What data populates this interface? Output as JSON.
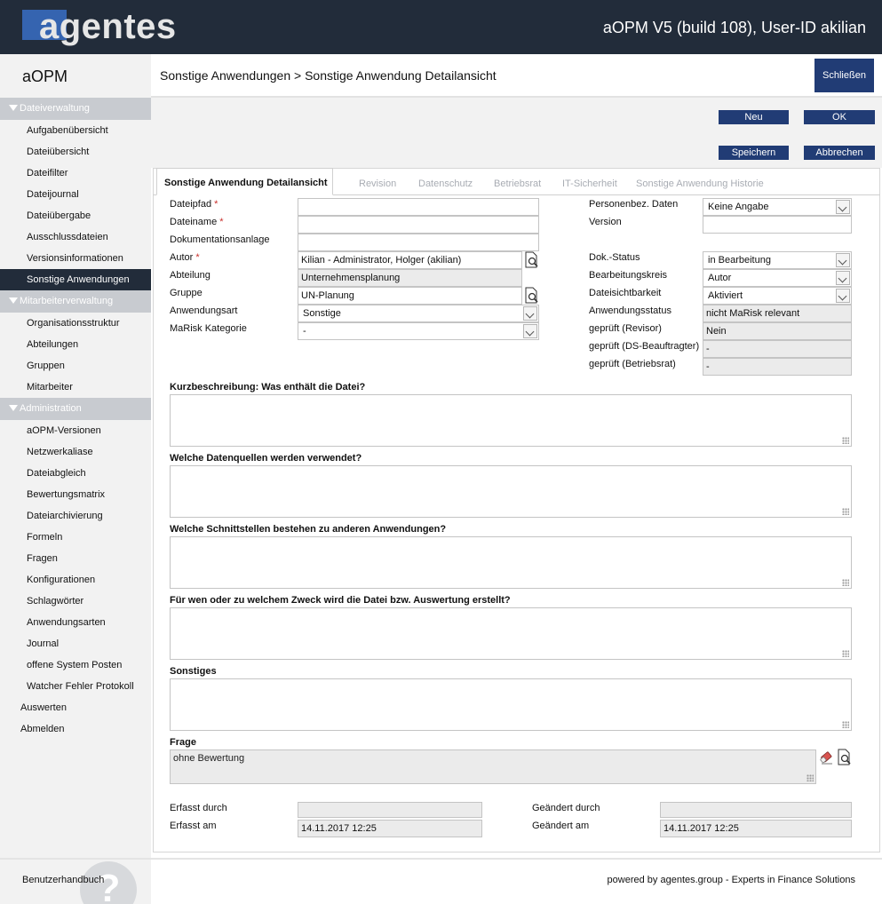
{
  "header": {
    "logo": "agentes",
    "app_info": "aOPM V5 (build 108), User-ID akilian"
  },
  "sidebar": {
    "title": "aOPM",
    "sections": [
      {
        "label": "Dateiverwaltung",
        "items": [
          "Aufgabenübersicht",
          "Dateiübersicht",
          "Dateifilter",
          "Dateijournal",
          "Dateiübergabe",
          "Ausschlussdateien",
          "Versionsinformationen",
          "Sonstige Anwendungen"
        ]
      },
      {
        "label": "Mitarbeiterverwaltung",
        "items": [
          "Organisationsstruktur",
          "Abteilungen",
          "Gruppen",
          "Mitarbeiter"
        ]
      },
      {
        "label": "Administration",
        "items": [
          "aOPM-Versionen",
          "Netzwerkaliase",
          "Dateiabgleich",
          "Bewertungsmatrix",
          "Dateiarchivierung",
          "Formeln",
          "Fragen",
          "Konfigurationen",
          "Schlagwörter",
          "Anwendungsarten",
          "Journal",
          "offene System Posten",
          "Watcher Fehler Protokoll"
        ]
      }
    ],
    "active_item": "Sonstige Anwendungen",
    "bottom_items": [
      "Auswerten",
      "Abmelden"
    ]
  },
  "page": {
    "breadcrumb": "Sonstige Anwendungen > Sonstige Anwendung Detailansicht",
    "close_label": "Schließen"
  },
  "toolbar": {
    "new_label": "Neu",
    "ok_label": "OK",
    "save_label": "Speichern",
    "cancel_label": "Abbrechen"
  },
  "tabs": [
    "Sonstige Anwendung Detailansicht",
    "Revision",
    "Datenschutz",
    "Betriebsrat",
    "IT-Sicherheit",
    "Sonstige Anwendung Historie"
  ],
  "form": {
    "required_mark": "*",
    "left": {
      "dateipfad": {
        "label": "Dateipfad",
        "value": ""
      },
      "dateiname": {
        "label": "Dateiname",
        "value": ""
      },
      "dokumentationsanlage": {
        "label": "Dokumentationsanlage",
        "value": ""
      },
      "autor": {
        "label": "Autor",
        "value": "Kilian - Administrator, Holger (akilian)"
      },
      "abteilung": {
        "label": "Abteilung",
        "value": "Unternehmensplanung"
      },
      "gruppe": {
        "label": "Gruppe",
        "value": "UN-Planung"
      },
      "anwendungsart": {
        "label": "Anwendungsart",
        "value": "Sonstige"
      },
      "marisk": {
        "label": "MaRisk Kategorie",
        "value": "-"
      }
    },
    "right": {
      "personenbez": {
        "label": "Personenbez. Daten",
        "value": "Keine Angabe"
      },
      "version": {
        "label": "Version",
        "value": ""
      },
      "dokstatus": {
        "label": "Dok.-Status",
        "value": "in Bearbeitung"
      },
      "bearbeitungskreis": {
        "label": "Bearbeitungskreis",
        "value": "Autor"
      },
      "sichtbarkeit": {
        "label": "Dateisichtbarkeit",
        "value": "Aktiviert"
      },
      "anwendungsstatus": {
        "label": "Anwendungsstatus",
        "value": "nicht MaRisk relevant"
      },
      "revisor": {
        "label": "geprüft (Revisor)",
        "value": "Nein"
      },
      "ds": {
        "label": "geprüft (DS-Beauftragter)",
        "value": "-"
      },
      "betriebsrat": {
        "label": "geprüft (Betriebsrat)",
        "value": "-"
      }
    },
    "q1": "Kurzbeschreibung: Was enthält die Datei?",
    "q2": "Welche Datenquellen werden verwendet?",
    "q3": "Welche Schnittstellen bestehen zu anderen Anwendungen?",
    "q4": "Für wen oder zu welchem Zweck wird die Datei bzw. Auswertung erstellt?",
    "q5": "Sonstiges",
    "frage": {
      "label": "Frage",
      "value": "ohne Bewertung"
    },
    "audit": {
      "erfasst_durch": {
        "label": "Erfasst durch",
        "value": ""
      },
      "erfasst_am": {
        "label": "Erfasst am",
        "value": "14.11.2017 12:25"
      },
      "geaendert_durch": {
        "label": "Geändert durch",
        "value": ""
      },
      "geaendert_am": {
        "label": "Geändert am",
        "value": "14.11.2017 12:25"
      }
    }
  },
  "footer": {
    "help_label": "Benutzerhandbuch",
    "powered_by": "powered by agentes.group - Experts in Finance Solutions"
  },
  "colors": {
    "header_bg": "#222c3a",
    "accent": "#213c75",
    "required": "#c9302c",
    "sidebar_section": "#c8cbd0"
  }
}
